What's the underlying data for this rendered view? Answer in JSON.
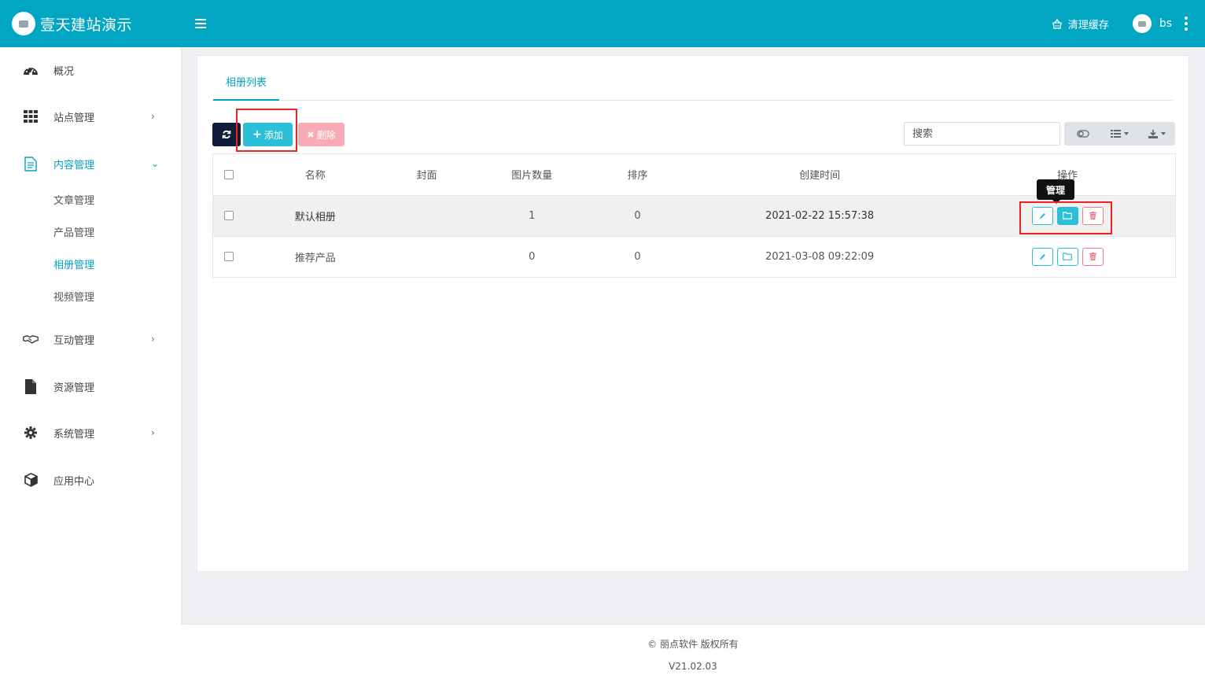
{
  "header": {
    "site_title": "壹天建站演示",
    "clear_cache": "清理缓存",
    "username": "bs"
  },
  "sidebar": {
    "items": [
      {
        "label": "概况",
        "icon": "dashboard-icon"
      },
      {
        "label": "站点管理",
        "icon": "grid-icon"
      },
      {
        "label": "内容管理",
        "icon": "document-icon",
        "expanded": true
      },
      {
        "label": "互动管理",
        "icon": "handshake-icon"
      },
      {
        "label": "资源管理",
        "icon": "file-icon"
      },
      {
        "label": "系统管理",
        "icon": "gear-icon"
      },
      {
        "label": "应用中心",
        "icon": "cube-icon"
      }
    ],
    "sub_items": [
      "文章管理",
      "产品管理",
      "相册管理",
      "视频管理"
    ],
    "active_sub": "相册管理"
  },
  "main": {
    "tab_label": "相册列表",
    "toolbar": {
      "add_label": "添加",
      "delete_label": "删除",
      "search_placeholder": "搜索"
    },
    "table": {
      "columns": [
        "名称",
        "封面",
        "图片数量",
        "排序",
        "创建时间",
        "操作"
      ],
      "rows": [
        {
          "name": "默认相册",
          "cover": "",
          "count": "1",
          "sort": "0",
          "created": "2021-02-22 15:57:38"
        },
        {
          "name": "推荐产品",
          "cover": "",
          "count": "0",
          "sort": "0",
          "created": "2021-03-08 09:22:09"
        }
      ]
    },
    "tooltip": "管理"
  },
  "footer": {
    "copyright": "© 丽点软件 版权所有",
    "version": "V21.02.03"
  },
  "colors": {
    "primary": "#00a6c2",
    "accent": "#2cc0d8",
    "danger_light": "#f8aab5",
    "dark": "#0f1d3a"
  }
}
